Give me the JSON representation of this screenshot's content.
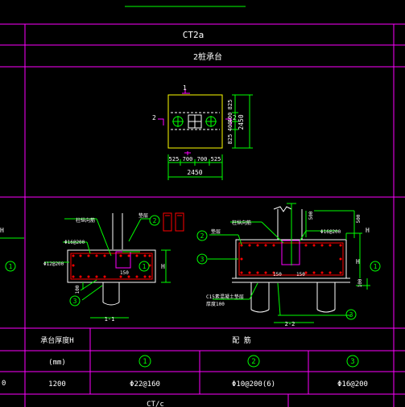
{
  "header": {
    "title": "CT2a",
    "subtitle": "2桩承台"
  },
  "plan": {
    "section_mark_top": "1",
    "section_mark_left": "2",
    "section_mark_right": "2",
    "dim_right_total": "2450",
    "dim_right_a": "825",
    "dim_right_b": "400",
    "dim_right_c": "400",
    "dim_right_d": "825",
    "dim_bottom_a": "525",
    "dim_bottom_b": "700",
    "dim_bottom_c": "700",
    "dim_bottom_d": "525",
    "dim_bottom_total": "2450"
  },
  "section1": {
    "label_top_a": "柱纵向筋",
    "label_top_b": "垫层",
    "rebar_a": "Φ16@200",
    "rebar_b": "Φ12@200",
    "dim_150": "150",
    "dim_100": "100",
    "height_label": "H",
    "caption": "1-1",
    "callouts": [
      "2",
      "1",
      "3"
    ]
  },
  "section2": {
    "label_top": "柱纵向筋",
    "label_pad": "垫层",
    "rebar": "Φ16@200",
    "dim_500a": "500",
    "dim_500b": "500",
    "dim_150a": "150",
    "dim_150b": "150",
    "dim_100": "100",
    "height_label": "H",
    "note_a": "C15素混凝土垫层",
    "note_b": "厚度100",
    "caption": "2-2",
    "callouts": [
      "2",
      "3",
      "1",
      "3"
    ]
  },
  "left_edge": {
    "label_h": "H",
    "callout": "1",
    "value": "0"
  },
  "table": {
    "col_height_header": "承台厚度H",
    "col_height_unit": "(mm)",
    "col_reinf_header": "配    筋",
    "reinf_numbers": [
      "1",
      "2",
      "3"
    ],
    "row_height": "1200",
    "row_reinf": [
      "Φ22@160",
      "Φ10@200(6)",
      "Φ16@200"
    ]
  },
  "footer": {
    "title": "CT/c"
  },
  "colors": {
    "frame": "#ff00ff",
    "text": "#ffffff",
    "green": "#00ff00",
    "yellow": "#ffff00",
    "red": "#ff0000"
  }
}
